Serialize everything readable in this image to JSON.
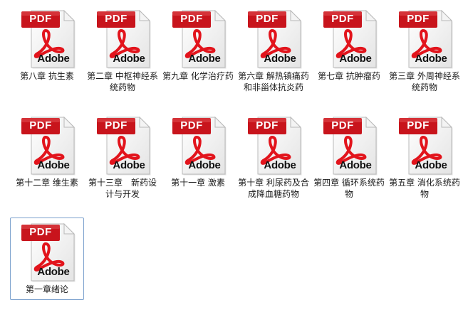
{
  "icon": {
    "type": "pdf-file-icon",
    "badge_text": "PDF",
    "brand_text": "Adobe",
    "badge_color": "#c8141c",
    "logo_color": "#e2141c"
  },
  "selection_color": "#7da2ce",
  "files": [
    {
      "name": "第八章 抗生素"
    },
    {
      "name": "第二章 中枢神经系统药物"
    },
    {
      "name": "第九章 化学治疗药"
    },
    {
      "name": "第六章 解热镇痛药和非甾体抗炎药"
    },
    {
      "name": "第七章 抗肿瘤药"
    },
    {
      "name": "第三章 外周神经系统药物"
    },
    {
      "name": "第十二章 维生素"
    },
    {
      "name": "第十三章　新药设计与开发"
    },
    {
      "name": "第十一章 激素"
    },
    {
      "name": "第十章 利尿药及合成降血糖药物"
    },
    {
      "name": "第四章 循环系统药物"
    },
    {
      "name": "第五章 消化系统药物"
    },
    {
      "name": "第一章绪论",
      "selected": true
    }
  ]
}
